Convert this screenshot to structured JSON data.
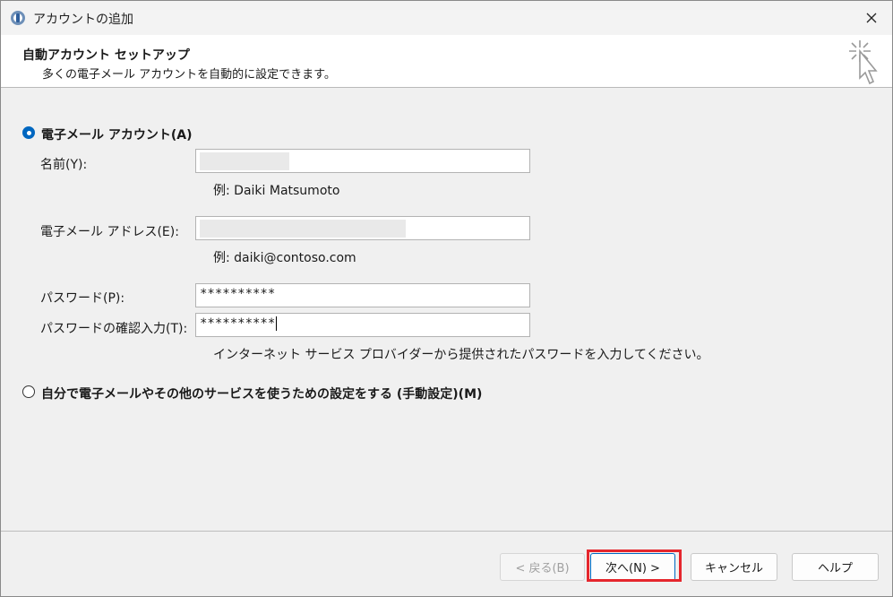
{
  "window": {
    "title": "アカウントの追加",
    "close_label": "✕"
  },
  "header": {
    "title": "自動アカウント セットアップ",
    "subtitle": "多くの電子メール アカウントを自動的に設定できます。",
    "icon": "sparkle-cursor-icon"
  },
  "auto_account": {
    "label": "電子メール アカウント(A)",
    "selected": true,
    "name_label": "名前(Y):",
    "name_example": "例: Daiki Matsumoto",
    "email_label": "電子メール アドレス(E):",
    "email_example": "例: daiki@contoso.com",
    "password_label": "パスワード(P):",
    "password_value": "**********",
    "confirm_label": "パスワードの確認入力(T):",
    "confirm_value": "**********",
    "password_hint": "インターネット サービス プロバイダーから提供されたパスワードを入力してください。"
  },
  "manual_setup": {
    "label": "自分で電子メールやその他のサービスを使うための設定をする (手動設定)(M)",
    "selected": false
  },
  "buttons": {
    "back": "< 戻る(B)",
    "next": "次へ(N) >",
    "cancel": "キャンセル",
    "help": "ヘルプ"
  },
  "colors": {
    "accent": "#0067c0",
    "highlight": "#e5262d"
  }
}
